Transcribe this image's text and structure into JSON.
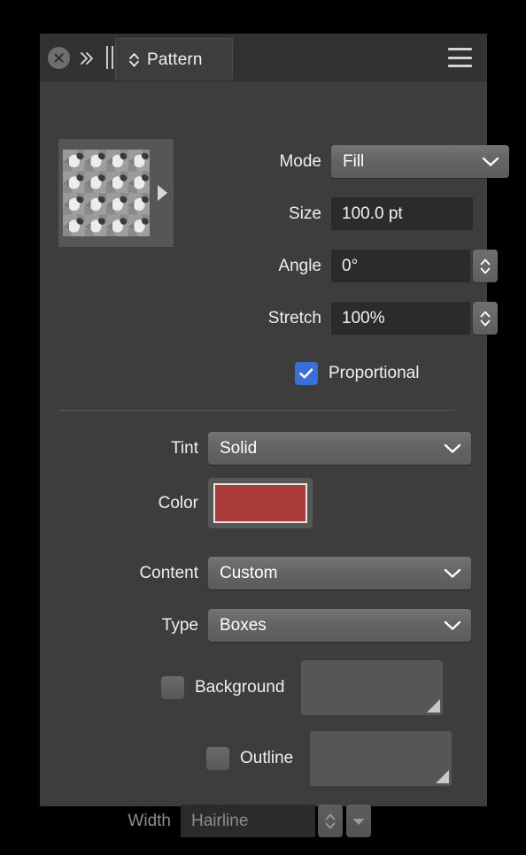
{
  "window": {
    "title": "Pattern",
    "background_color": "#000000",
    "panel_color": "#3d3d3d"
  },
  "tabbar": {
    "close_label": "",
    "close_icon": "close-circle-icon",
    "collapse_icon": "double-chevron-right-icon",
    "drag_handle_icon": "drag-bars-icon",
    "menu_icon": "hamburger-menu-icon",
    "tab": {
      "label": "Pattern",
      "sort_icon": "up-down-chevron-icon",
      "active": true
    }
  },
  "preview": {
    "name": "pattern-preview",
    "expand_icon": "play-triangle-icon",
    "alt": "grayscale tiled pattern preview"
  },
  "fields": {
    "mode": {
      "label": "Mode",
      "value": "Fill",
      "control": "dropdown",
      "chevron_icon": "chevron-down-icon"
    },
    "size": {
      "label": "Size",
      "value": "100.0 pt",
      "control": "textfield"
    },
    "angle": {
      "label": "Angle",
      "value": "0°",
      "control": "textfield-stepper",
      "stepper_icon": "stepper-up-down-icon"
    },
    "stretch": {
      "label": "Stretch",
      "value": "100%",
      "control": "textfield-stepper",
      "stepper_icon": "stepper-up-down-icon"
    },
    "proportional": {
      "label": "Proportional",
      "checked": true,
      "control": "checkbox",
      "check_icon": "checkmark-icon",
      "accent_color": "#3a6fd8"
    },
    "tint": {
      "label": "Tint",
      "value": "Solid",
      "control": "dropdown",
      "chevron_icon": "chevron-down-icon"
    },
    "color": {
      "label": "Color",
      "swatch_color": "#a93c3b",
      "control": "color-swatch"
    },
    "content": {
      "label": "Content",
      "value": "Custom",
      "control": "dropdown",
      "chevron_icon": "chevron-down-icon"
    },
    "type": {
      "label": "Type",
      "value": "Boxes",
      "control": "dropdown",
      "chevron_icon": "chevron-down-icon"
    },
    "background": {
      "label": "Background",
      "checked": false,
      "control": "checkbox",
      "well_value": "",
      "well_icon": "resize-grip-icon"
    },
    "outline": {
      "label": "Outline",
      "checked": false,
      "control": "checkbox",
      "well_value": "",
      "well_icon": "resize-grip-icon"
    },
    "width": {
      "label": "Width",
      "value": "Hairline",
      "control": "textfield-stepper-dropdown",
      "disabled": true,
      "stepper_icon": "stepper-up-down-icon",
      "dropdown_icon": "triangle-down-icon"
    }
  }
}
